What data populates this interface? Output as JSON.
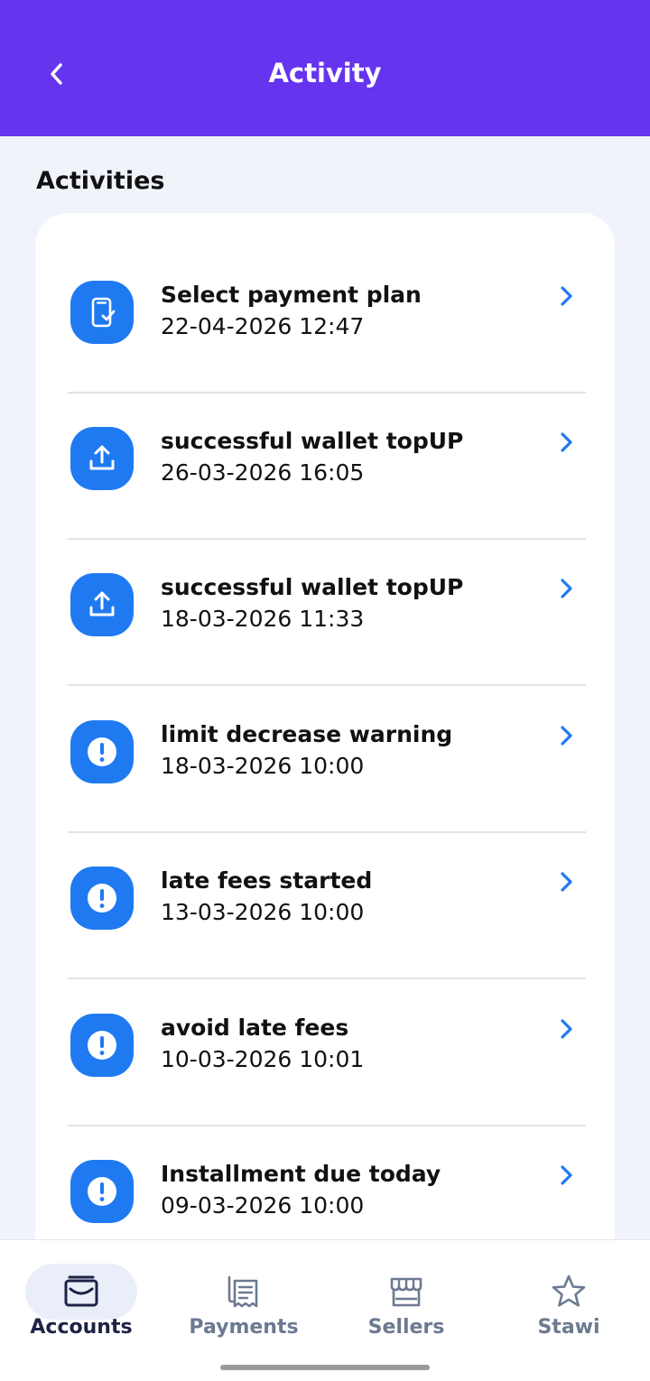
{
  "header": {
    "title": "Activity",
    "back_icon": "chevron-left-icon"
  },
  "section_title": "Activities",
  "activities": [
    {
      "title": "Select payment plan",
      "date": "22-04-2026 12:47",
      "icon": "phone-check-icon"
    },
    {
      "title": "successful wallet topUP",
      "date": "26-03-2026 16:05",
      "icon": "upload-icon"
    },
    {
      "title": "successful wallet topUP",
      "date": "18-03-2026 11:33",
      "icon": "upload-icon"
    },
    {
      "title": "limit decrease warning",
      "date": "18-03-2026 10:00",
      "icon": "alert-icon"
    },
    {
      "title": "late fees started",
      "date": "13-03-2026 10:00",
      "icon": "alert-icon"
    },
    {
      "title": "avoid late fees",
      "date": "10-03-2026 10:01",
      "icon": "alert-icon"
    },
    {
      "title": "Installment due today",
      "date": "09-03-2026 10:00",
      "icon": "alert-icon"
    }
  ],
  "nav": [
    {
      "label": "Accounts",
      "icon": "wallet-icon",
      "active": true
    },
    {
      "label": "Payments",
      "icon": "receipt-icon",
      "active": false
    },
    {
      "label": "Sellers",
      "icon": "store-icon",
      "active": false
    },
    {
      "label": "Stawi",
      "icon": "star-icon",
      "active": false
    }
  ],
  "colors": {
    "header": "#6634ee",
    "accent": "#1f7af2",
    "background": "#f0f3fa"
  }
}
